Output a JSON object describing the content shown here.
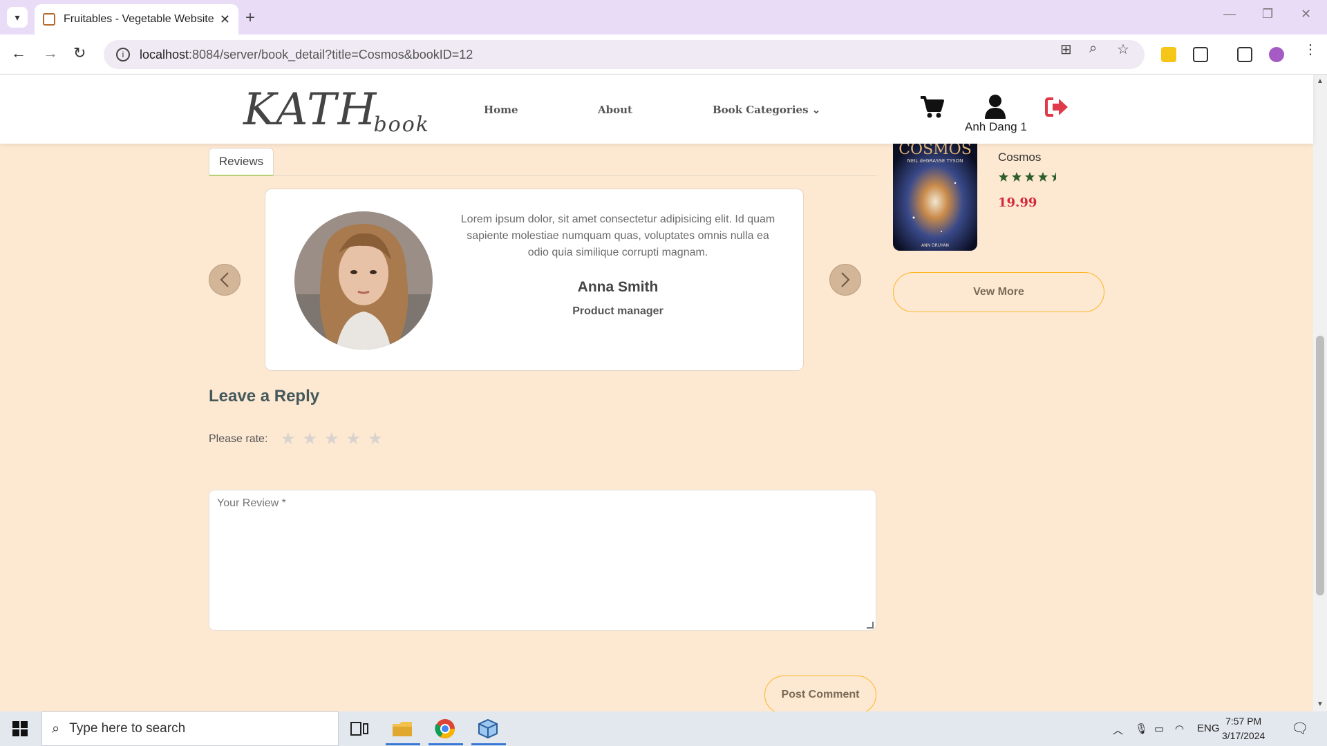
{
  "browser": {
    "tab_title": "Fruitables - Vegetable Website",
    "new_tab": "+",
    "url_host": "localhost",
    "url_path": ":8084/server/book_detail?title=Cosmos&bookID=12"
  },
  "header": {
    "logo_main": "KATH",
    "logo_sub": "book",
    "nav": {
      "home": "Home",
      "about": "About",
      "categories": "Book Categories"
    },
    "user_name": "Anh Dang 1"
  },
  "reviews_tab": "Reviews",
  "testimonial": {
    "text": "Lorem ipsum dolor, sit amet consectetur adipisicing elit. Id quam sapiente molestiae numquam quas, voluptates omnis nulla ea odio quia similique corrupti magnam.",
    "name": "Anna Smith",
    "role": "Product manager"
  },
  "sidebar_book": {
    "cover_title": "COSMOS",
    "cover_subtitle": "NEIL deGRASSE TYSON",
    "cover_author": "ANN DRUYAN",
    "title": "Cosmos",
    "rating": 4.5,
    "price": "19.99",
    "view_more": "Vew More"
  },
  "reply": {
    "title": "Leave a Reply",
    "rate_label": "Please rate:",
    "review_placeholder": "Your Review *",
    "post_button": "Post Comment"
  },
  "taskbar": {
    "search_placeholder": "Type here to search",
    "lang": "ENG",
    "time": "7:57 PM",
    "date": "3/17/2024"
  },
  "colors": {
    "page_bg": "#fde8d2",
    "accent": "#ffb524",
    "price": "#d4293a",
    "star_green": "#2e5e2a",
    "logout_red": "#e03a4a"
  }
}
